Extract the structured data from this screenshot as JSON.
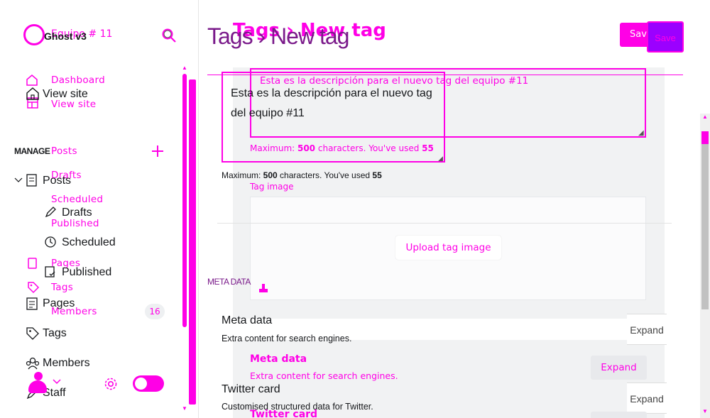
{
  "app": {
    "logo_text_a": "Ghost v3",
    "logo_text_b": "Equipo # 11"
  },
  "sidebar": {
    "nav_a": {
      "dashboard": "Dashboard",
      "view_site": "View site",
      "posts": "Posts",
      "drafts": "Drafts",
      "scheduled": "Scheduled",
      "published": "Published",
      "pages": "Pages",
      "tags": "Tags",
      "members": "Members",
      "members_count": "16"
    },
    "nav_b": {
      "view_site": "View site",
      "manage": "MANAGE",
      "posts": "Posts",
      "drafts": "Drafts",
      "scheduled": "Scheduled",
      "published": "Published",
      "pages": "Pages",
      "tags": "Tags",
      "members": "Members",
      "staff": "Staff"
    }
  },
  "header": {
    "breadcrumb_parent": "Tags",
    "breadcrumb_sep": "›",
    "title": "New tag",
    "save_label_a": "Save",
    "save_label_b": "Save"
  },
  "form": {
    "description_a": "Esta es la descripción para el nuevo tag del equipo #11",
    "description_b": "Esta es la descripción para el nuevo tag del equipo #11",
    "counter_a_prefix": "Maximum: ",
    "counter_a_max": "500",
    "counter_a_mid": " characters. You've used ",
    "counter_a_used": "55",
    "counter_b_prefix": "Maximum: ",
    "counter_b_max": "500",
    "counter_b_mid": " characters. You've used ",
    "counter_b_used": "55",
    "tag_image_label": "Tag image",
    "upload_button": "Upload tag image"
  },
  "meta": {
    "section_title": "META DATA",
    "meta_title_a": "Meta data",
    "meta_desc_a": "Extra content for search engines.",
    "meta_title_b": "Meta data",
    "meta_desc_b": "Extra content for search engines.",
    "expand_a": "Expand",
    "expand_b": "Expand",
    "twitter_title_a": "Twitter card",
    "twitter_desc_a": "Customised structured data for Twitter.",
    "twitter_title_b": "Twitter card",
    "expand_c": "Expand"
  },
  "colors": {
    "accent": "#ff00e6",
    "save_bg": "#ff00e6",
    "save_bg_b": "#9b00ff",
    "panel": "#f1f2f3"
  }
}
